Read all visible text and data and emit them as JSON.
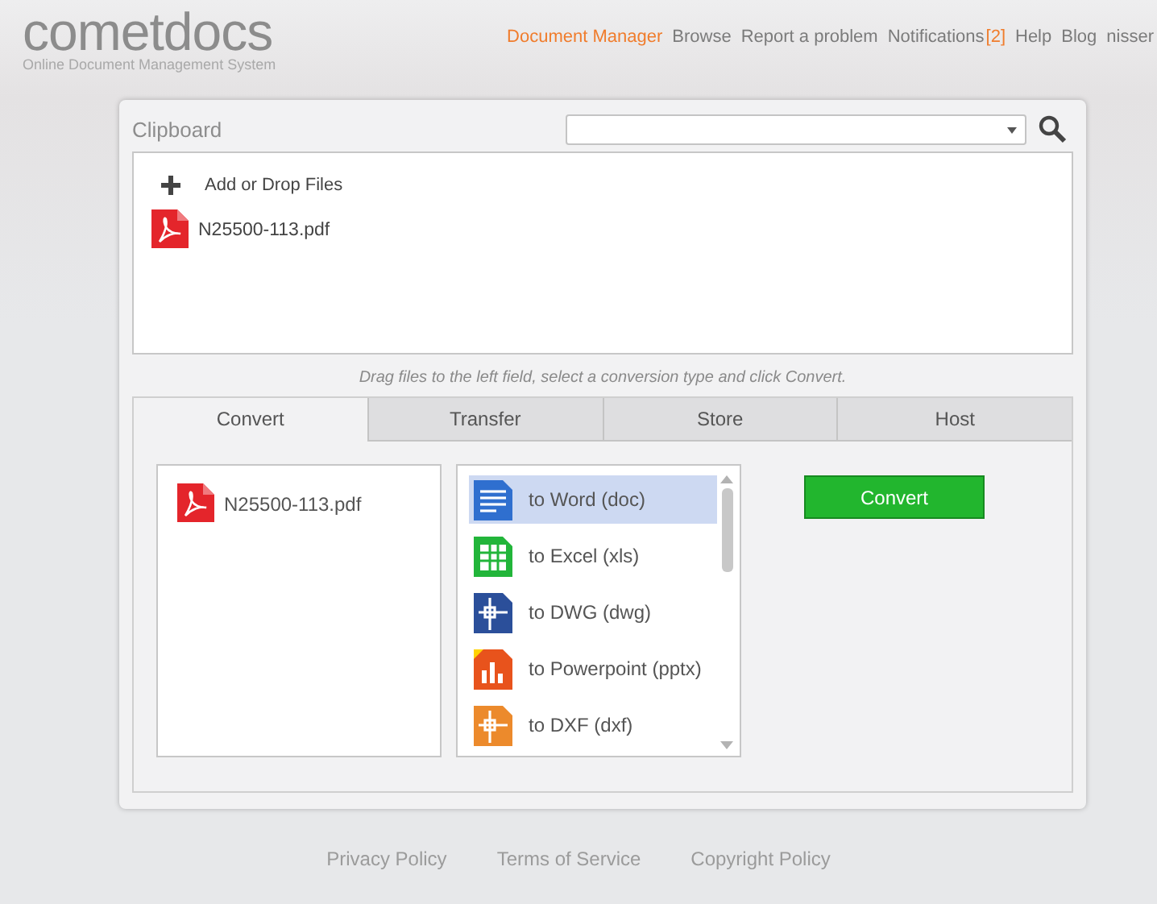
{
  "header": {
    "logo": "cometdocs",
    "tagline": "Online Document Management System",
    "nav": [
      {
        "label": "Document Manager",
        "selected": true
      },
      {
        "label": "Browse",
        "selected": false
      },
      {
        "label": "Report a problem",
        "selected": false
      },
      {
        "label": "Notifications",
        "selected": false,
        "badge": "[2]"
      },
      {
        "label": "Help",
        "selected": false
      },
      {
        "label": "Blog",
        "selected": false
      },
      {
        "label": "nisser",
        "selected": false
      }
    ]
  },
  "clipboard": {
    "title": "Clipboard",
    "add_label": "Add or Drop Files",
    "files": [
      "N25500-113.pdf"
    ]
  },
  "hint": "Drag files to the left field, select a conversion type and click Convert.",
  "tabs": [
    {
      "label": "Convert",
      "selected": true
    },
    {
      "label": "Transfer",
      "selected": false
    },
    {
      "label": "Store",
      "selected": false
    },
    {
      "label": "Host",
      "selected": false
    }
  ],
  "convert": {
    "files": [
      "N25500-113.pdf"
    ],
    "types": [
      {
        "label": "to Word (doc)",
        "kind": "word",
        "selected": true
      },
      {
        "label": "to Excel (xls)",
        "kind": "excel",
        "selected": false
      },
      {
        "label": "to DWG (dwg)",
        "kind": "dwg",
        "selected": false
      },
      {
        "label": "to Powerpoint (pptx)",
        "kind": "pptx",
        "selected": false
      },
      {
        "label": "to DXF (dxf)",
        "kind": "dxf",
        "selected": false
      }
    ],
    "button": "Convert"
  },
  "footer": [
    "Privacy Policy",
    "Terms of Service",
    "Copyright Policy"
  ]
}
